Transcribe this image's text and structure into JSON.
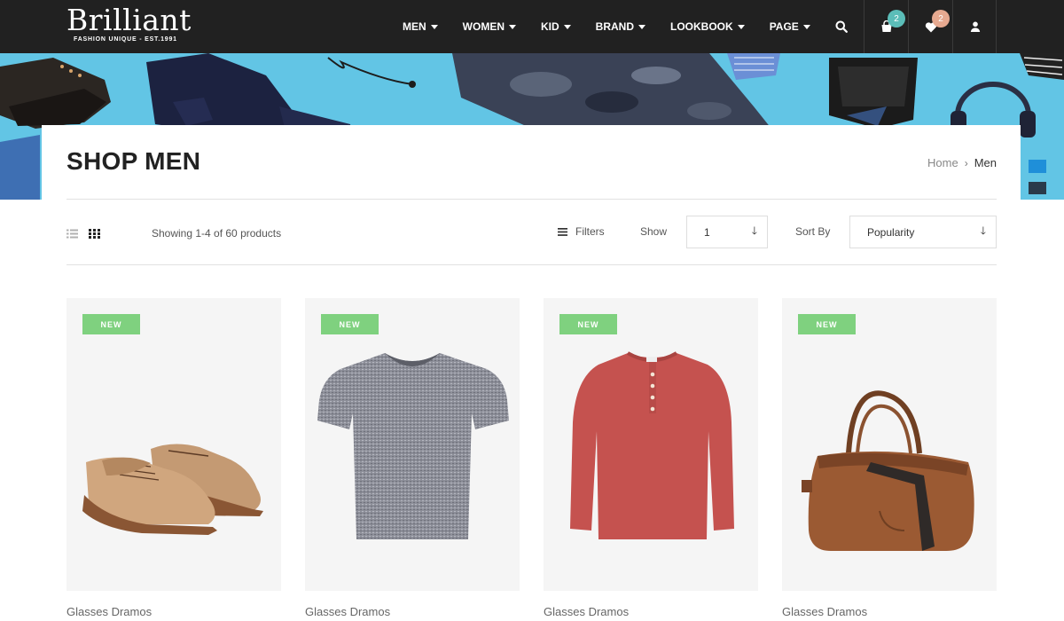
{
  "brand": {
    "name": "Brilliant",
    "tagline": "FASHION UNIQUE - EST.1991"
  },
  "nav": [
    {
      "label": "MEN"
    },
    {
      "label": "WOMEN"
    },
    {
      "label": "KID"
    },
    {
      "label": "BRAND"
    },
    {
      "label": "LOOKBOOK"
    },
    {
      "label": "PAGE"
    }
  ],
  "header_icons": {
    "cart_count": "2",
    "wishlist_count": "2",
    "cart_badge_color": "#5bbdb8",
    "wishlist_badge_color": "#e6a990"
  },
  "page": {
    "title": "SHOP MEN"
  },
  "breadcrumb": {
    "home": "Home",
    "separator": "›",
    "current": "Men"
  },
  "toolbar": {
    "showing": "Showing 1-4 of 60 products",
    "filters": "Filters",
    "show_label": "Show",
    "show_value": "1",
    "sort_label": "Sort By",
    "sort_value": "Popularity"
  },
  "products": [
    {
      "badge": "NEW",
      "name": "Glasses Dramos",
      "image": "suede-derby-shoes"
    },
    {
      "badge": "NEW",
      "name": "Glasses Dramos",
      "image": "grey-heather-tshirt"
    },
    {
      "badge": "NEW",
      "name": "Glasses Dramos",
      "image": "red-henley-longsleeve"
    },
    {
      "badge": "NEW",
      "name": "Glasses Dramos",
      "image": "brown-leather-duffel-bag"
    }
  ],
  "colors": {
    "header_bg": "#212121",
    "banner_bg": "#5ec3e3",
    "new_badge": "#7fd17f"
  }
}
